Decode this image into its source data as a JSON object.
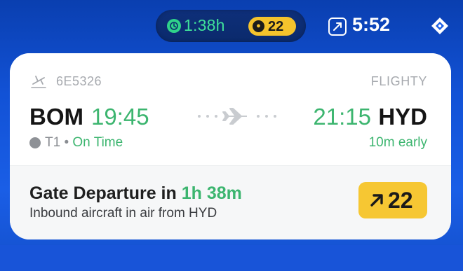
{
  "status_bar": {
    "timer_text": "1:38h",
    "gate_pill_text": "22",
    "gate_pill_icon": "gate-marker-icon",
    "clock": "5:52",
    "icons": [
      "timer-icon",
      "navigation-icon",
      "diamond-icon"
    ]
  },
  "card": {
    "flight_number": "6E5326",
    "brand": "FLIGHTY",
    "departure": {
      "code": "BOM",
      "time": "19:45",
      "terminal": "T1",
      "separator": " • ",
      "status": "On Time"
    },
    "arrival": {
      "time": "21:15",
      "code": "HYD",
      "status": "10m early"
    },
    "gate": {
      "heading_prefix": "Gate Departure in ",
      "heading_accent": "1h 38m",
      "subtext": "Inbound aircraft in air from HYD",
      "badge_text": "22"
    }
  },
  "colors": {
    "background": "#1252d6",
    "accent_green": "#3cb56f",
    "gate_yellow": "#f6c733",
    "text_dark": "#151515",
    "text_muted": "#a6a9ae"
  }
}
